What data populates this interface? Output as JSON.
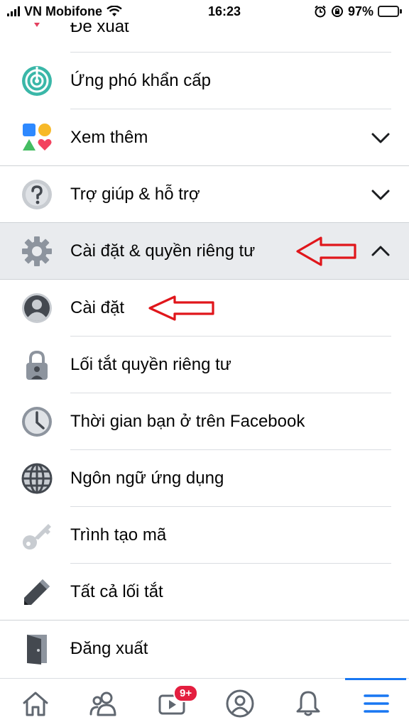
{
  "status_bar": {
    "carrier": "VN Mobifone",
    "time": "16:23",
    "battery": "97%",
    "battery_level": 0.97
  },
  "menu": {
    "suggestions_label": "Đề xuất",
    "emergency_label": "Ứng phó khẩn cấp",
    "see_more_label": "Xem thêm",
    "help_label": "Trợ giúp & hỗ trợ",
    "settings_privacy_label": "Cài đặt & quyền riêng tư",
    "settings_label": "Cài đặt",
    "privacy_shortcuts_label": "Lối tắt quyền riêng tư",
    "time_on_facebook_label": "Thời gian bạn ở trên Facebook",
    "app_language_label": "Ngôn ngữ ứng dụng",
    "code_generator_label": "Trình tạo mã",
    "all_shortcuts_label": "Tất cả lối tắt",
    "logout_label": "Đăng xuất"
  },
  "tabbar": {
    "watch_badge": "9+",
    "active_tab": "menu"
  },
  "colors": {
    "accent": "#1877f2",
    "badge": "#e41e3f",
    "annotation_arrow": "#e0161b",
    "shaded_row": "#e9ebee"
  }
}
